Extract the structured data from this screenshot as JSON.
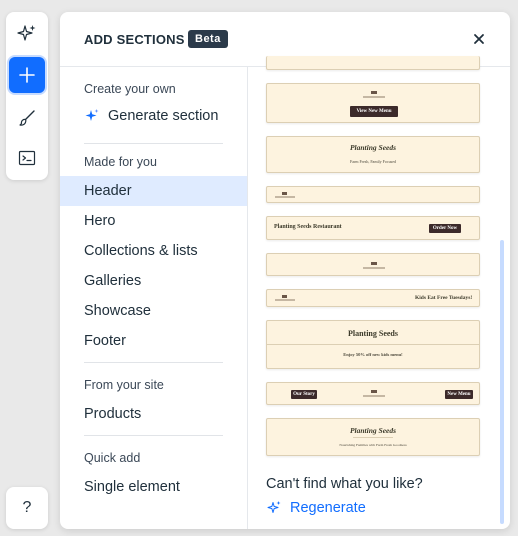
{
  "panel": {
    "title": "ADD SECTIONS",
    "badge": "Beta"
  },
  "toolbar": {
    "tools": [
      "ai-sparkle-icon",
      "plus-icon",
      "brush-icon",
      "terminal-icon"
    ],
    "help": "?"
  },
  "nav": {
    "create_heading": "Create your own",
    "generate_label": "Generate section",
    "made_heading": "Made for you",
    "items": [
      "Header",
      "Hero",
      "Collections & lists",
      "Galleries",
      "Showcase",
      "Footer"
    ],
    "selected": "Header",
    "site_heading": "From your site",
    "site_items": [
      "Products"
    ],
    "quick_heading": "Quick add",
    "quick_items": [
      "Single element"
    ]
  },
  "previews": {
    "p1_button": "View New Menu",
    "p2_title": "Planting Seeds",
    "p2_sub": "Farm Fresh, Family Focused",
    "p4_title": "Planting Seeds Restaurant",
    "p4_button": "Order Now",
    "p6_right": "Kids Eat Free Tuesdays!",
    "p7_title": "Planting Seeds",
    "p7_sub": "Enjoy 50% off new kids menu!",
    "p8_left": "Our Story",
    "p8_right": "New Menu",
    "p9_title": "Planting Seeds",
    "p9_sub": "Nourishing Families with Farm Fresh Goodness"
  },
  "footer": {
    "question": "Can't find what you like?",
    "regenerate": "Regenerate"
  },
  "colors": {
    "accent": "#116dff",
    "selected_bg": "#dfebff",
    "preview_bg": "#fdf3df",
    "preview_button": "#3c2a2a"
  }
}
